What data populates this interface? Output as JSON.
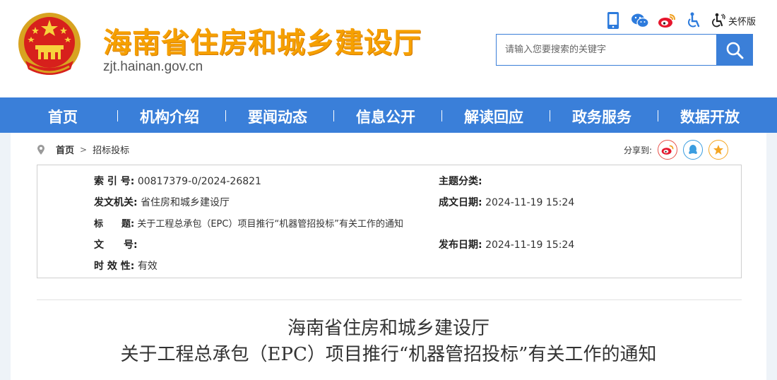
{
  "header": {
    "site_title": "海南省住房和城乡建设厅",
    "site_url": "zjt.hainan.gov.cn",
    "care_mode_label": "关怀版",
    "icons": [
      "mobile-icon",
      "wechat-icon",
      "weibo-icon",
      "accessibility-icon",
      "care-mode-icon"
    ],
    "search_placeholder": "请输入您要搜索的关键字"
  },
  "nav": {
    "items": [
      "首页",
      "机构介绍",
      "要闻动态",
      "信息公开",
      "解读回应",
      "政务服务",
      "数据开放"
    ]
  },
  "breadcrumb": {
    "home": "首页",
    "separator": ">",
    "current": "招标投标"
  },
  "share": {
    "label": "分享到:",
    "targets": [
      "weibo-icon",
      "qq-icon",
      "favorite-icon"
    ]
  },
  "info": {
    "index_label": "索 引 号:",
    "index_value": "00817379-0/2024-26821",
    "category_label": "主题分类:",
    "category_value": "",
    "issuer_label": "发文机关:",
    "issuer_value": "省住房和城乡建设厅",
    "written_date_label": "成文日期:",
    "written_date_value": "2024-11-19 15:24",
    "title_label": "标　　题:",
    "title_value": "关于工程总承包（EPC）项目推行“机器管招投标”有关工作的通知",
    "doc_no_label": "文　　号:",
    "doc_no_value": "",
    "publish_date_label": "发布日期:",
    "publish_date_value": "2024-11-19 15:24",
    "validity_label": "时 效 性:",
    "validity_value": "有效"
  },
  "document": {
    "title_line1": "海南省住房和城乡建设厅",
    "title_line2": "关于工程总承包（EPC）项目推行“机器管招投标”有关工作的通知"
  },
  "colors": {
    "nav_blue": "#3a7fd9",
    "title_orange": "#f6a000",
    "weibo_red": "#e6162d",
    "qq_blue": "#3a9de0",
    "fav_orange": "#f5a623"
  }
}
